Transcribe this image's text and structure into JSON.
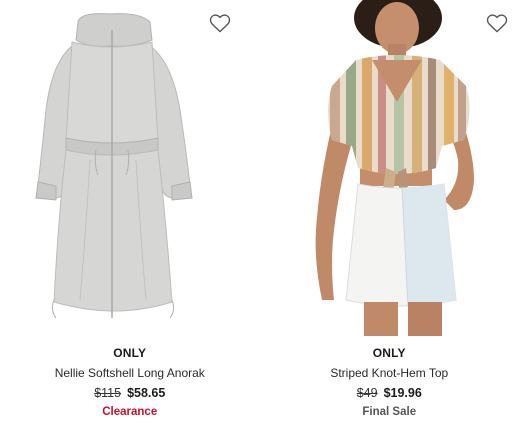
{
  "products": [
    {
      "brand": "ONLY",
      "name": "Nellie Softshell Long Anorak",
      "original_price": "$115",
      "sale_price": "$58.65",
      "tag": "Clearance",
      "tag_color": "#c8102e",
      "wishlist_icon": "heart-outline-icon"
    },
    {
      "brand": "ONLY",
      "name": "Striped Knot-Hem Top",
      "original_price": "$49",
      "sale_price": "$19.96",
      "tag": "Final Sale",
      "tag_color": "#555555",
      "wishlist_icon": "heart-outline-icon"
    }
  ]
}
